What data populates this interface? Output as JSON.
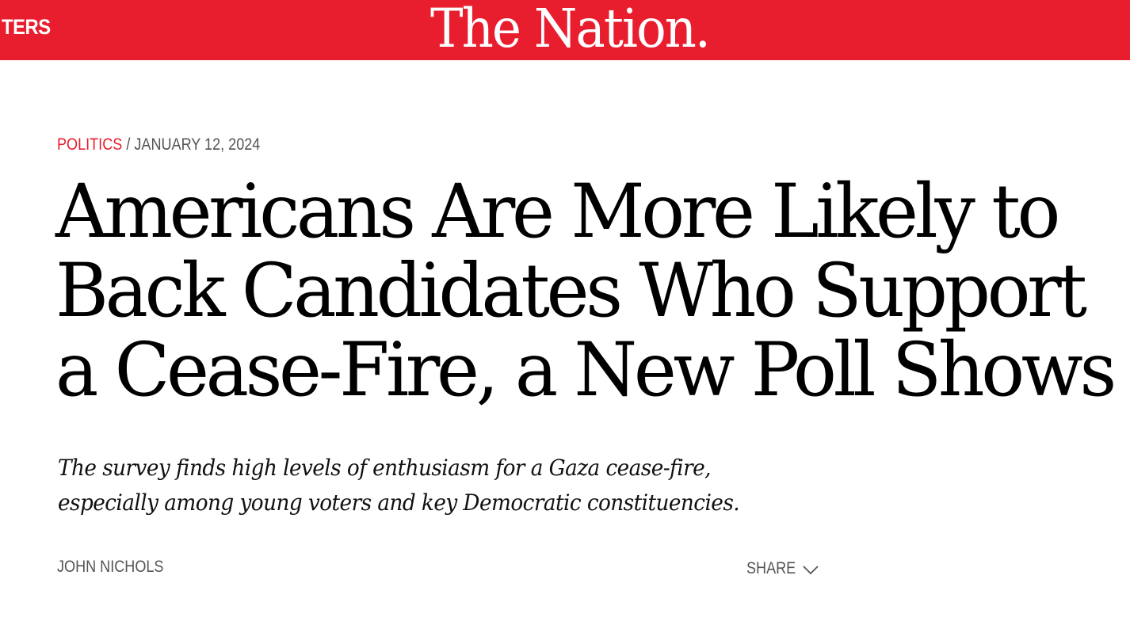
{
  "header": {
    "left_label": "TERS",
    "logo": "The Nation."
  },
  "article": {
    "category": "POLITICS",
    "separator": "/",
    "date": "JANUARY 12, 2024",
    "headline_lines": [
      "Americans Are More Likely to",
      "Back Candidates Who Support",
      "a Cease-Fire, a New Poll Shows"
    ],
    "dek_lines": [
      "The survey finds high levels of enthusiasm for a Gaza cease-fire,",
      "especially among young voters and key Democratic constituencies."
    ],
    "author": "JOHN NICHOLS",
    "share_label": "SHARE",
    "share_icon": "chevron-down-icon"
  },
  "colors": {
    "brand_red": "#e81e2e",
    "meta_gray": "#555555",
    "text": "#000000"
  }
}
